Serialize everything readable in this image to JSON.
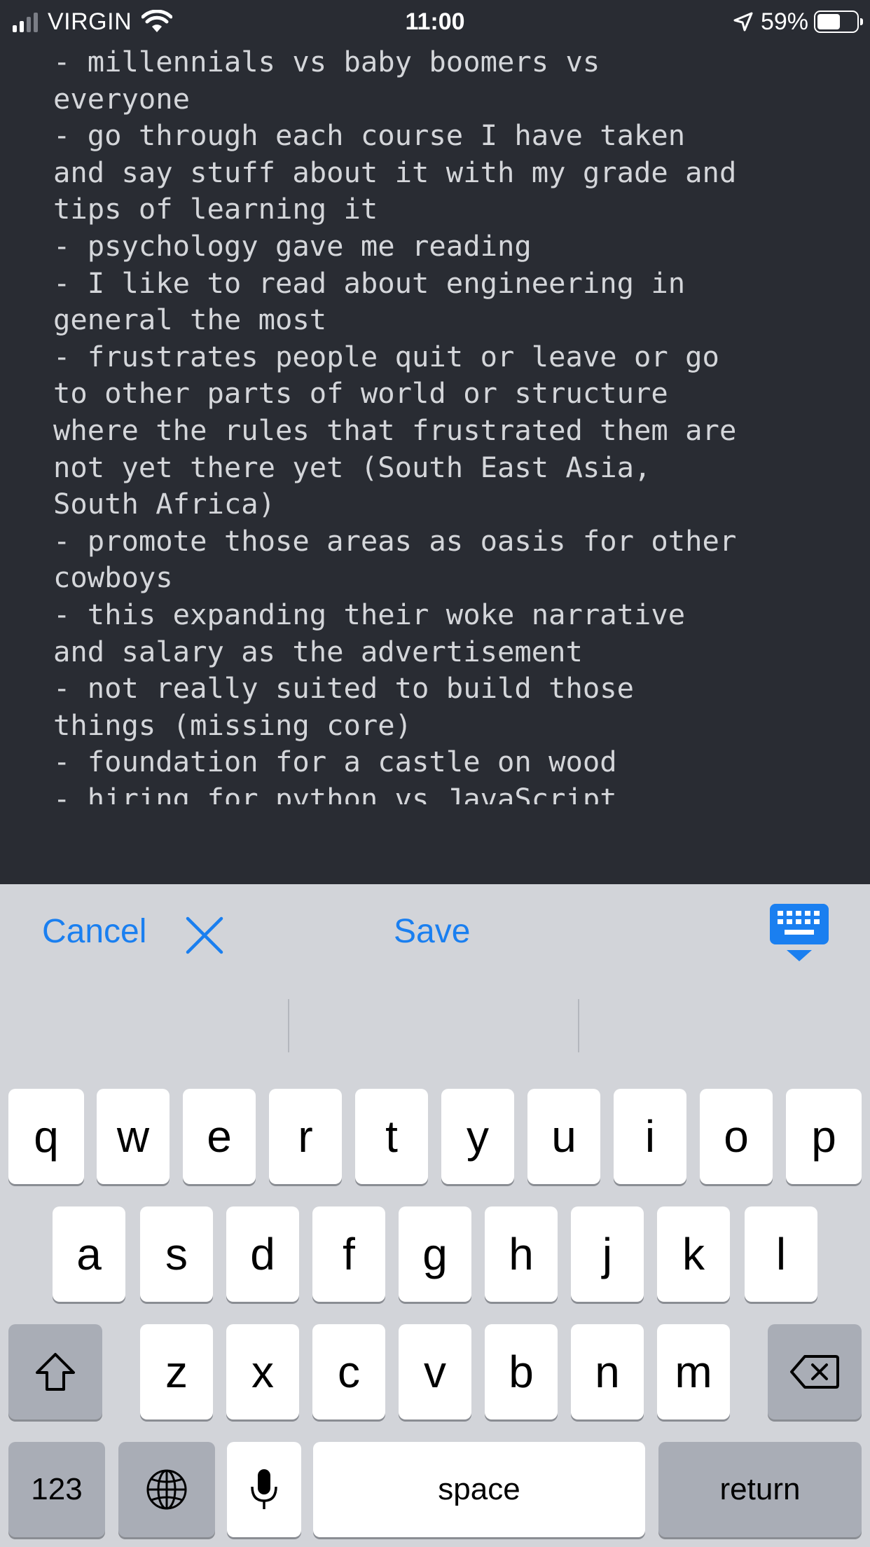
{
  "status_bar": {
    "carrier": "VIRGIN",
    "time": "11:00",
    "battery": "59%",
    "battery_level": 0.59,
    "signal_bars_filled": 2,
    "signal_bars_total": 4,
    "icons": [
      "signal-icon",
      "wifi-icon",
      "location-arrow-icon",
      "battery-icon"
    ]
  },
  "editor": {
    "text": "- millennials vs baby boomers vs\neveryone\n- go through each course I have taken\nand say stuff about it with my grade and\ntips of learning it\n- psychology gave me reading\n- I like to read about engineering in\ngeneral the most\n- frustrates people quit or leave or go\nto other parts of world or structure\nwhere the rules that frustrated them are\nnot yet there yet (South East Asia,\nSouth Africa)\n- promote those areas as oasis for other\ncowboys\n- this expanding their woke narrative\nand salary as the advertisement\n- not really suited to build those\nthings (missing core)\n- foundation for a castle on wood\n- hiring for python vs JavaScript"
  },
  "toolbar": {
    "cancel_label": "Cancel",
    "save_label": "Save",
    "icons": [
      "close-icon",
      "keyboard-dismiss-icon"
    ]
  },
  "keyboard": {
    "row1": [
      "q",
      "w",
      "e",
      "r",
      "t",
      "y",
      "u",
      "i",
      "o",
      "p"
    ],
    "row2": [
      "a",
      "s",
      "d",
      "f",
      "g",
      "h",
      "j",
      "k",
      "l"
    ],
    "row3": [
      "z",
      "x",
      "c",
      "v",
      "b",
      "n",
      "m"
    ],
    "numbers_label": "123",
    "space_label": "space",
    "return_label": "return",
    "icons": [
      "shift-icon",
      "delete-icon",
      "globe-icon",
      "microphone-icon"
    ]
  },
  "colors": {
    "editor_background": "#292c33",
    "editor_text": "#d4d6da",
    "accent": "#1a7ff0",
    "keyboard_background": "#d2d4d9"
  }
}
